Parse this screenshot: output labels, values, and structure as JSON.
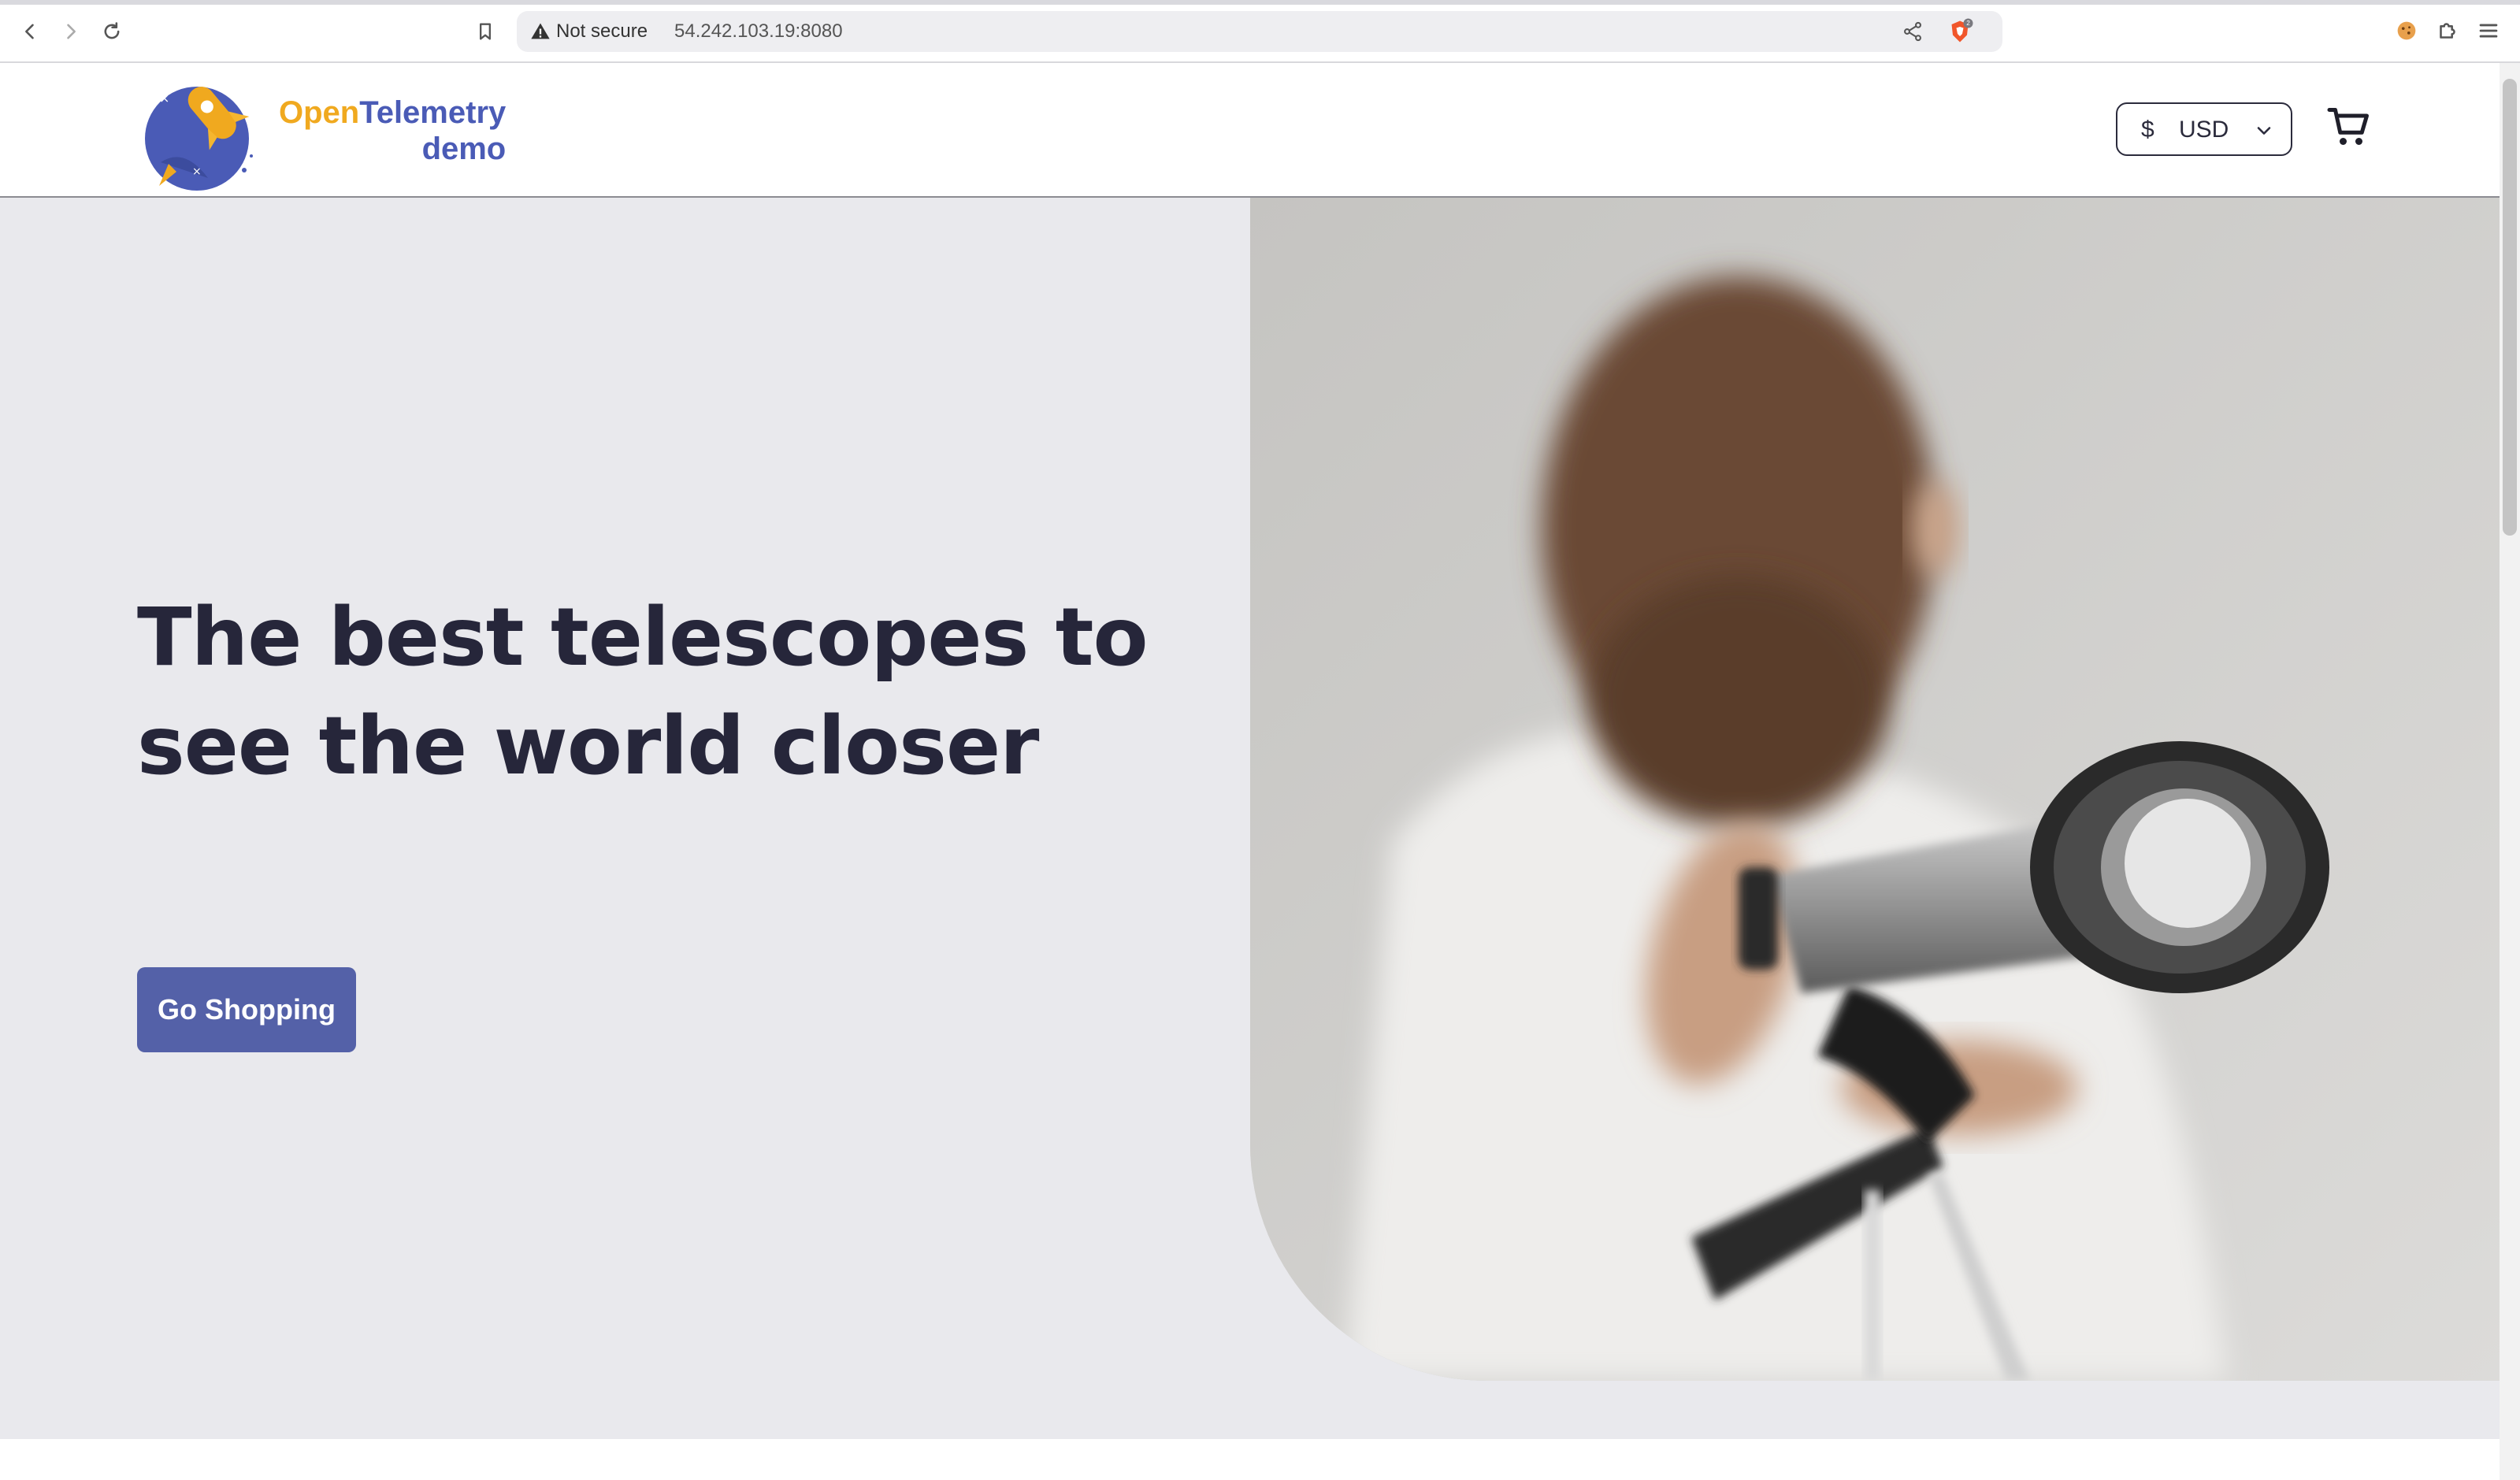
{
  "browser": {
    "security_label": "Not secure",
    "url": "54.242.103.19:8080",
    "brave_shield_count": "2"
  },
  "site": {
    "brand_open": "Open",
    "brand_telemetry": "Telemetry",
    "brand_demo": "demo",
    "currency_symbol": "$",
    "currency_code": "USD"
  },
  "hero": {
    "title": "The best telescopes to see the world closer",
    "cta_label": "Go Shopping"
  },
  "colors": {
    "brand_orange": "#f0a91f",
    "brand_blue": "#4a5bb6",
    "cta_background": "#5461a8",
    "title_text": "#26263a",
    "hero_background": "#e9e9ed"
  },
  "icons": [
    "back-icon",
    "forward-icon",
    "reload-icon",
    "bookmark-icon",
    "warning-icon",
    "share-icon",
    "brave-shield-icon",
    "cookie-extension-icon",
    "puzzle-extensions-icon",
    "menu-icon",
    "chevron-down-icon",
    "cart-icon"
  ]
}
